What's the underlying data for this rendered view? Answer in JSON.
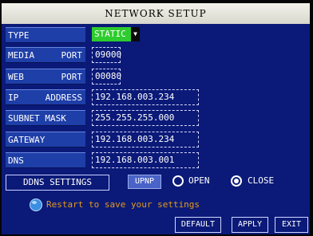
{
  "window": {
    "title": "NETWORK SETUP"
  },
  "form": {
    "type": {
      "label": "TYPE",
      "value": "STATIC"
    },
    "media_port": {
      "label_a": "MEDIA",
      "label_b": "PORT",
      "value": "09000"
    },
    "web_port": {
      "label_a": "WEB",
      "label_b": "PORT",
      "value": "00080"
    },
    "ip_address": {
      "label_a": "IP",
      "label_b": "ADDRESS",
      "value": "192.168.003.234"
    },
    "subnet_mask": {
      "label": "SUBNET MASK",
      "value": "255.255.255.000"
    },
    "gateway": {
      "label": "GATEWAY",
      "value": "192.168.003.234"
    },
    "dns": {
      "label": "DNS",
      "value": "192.168.003.001"
    }
  },
  "ddns": {
    "label": "DDNS SETTINGS"
  },
  "upnp": {
    "label": "UPNP",
    "options": [
      "OPEN",
      "CLOSE"
    ],
    "selected": "CLOSE"
  },
  "message": {
    "text": "Restart to save your settings"
  },
  "buttons": {
    "default": "DEFAULT",
    "apply": "APPLY",
    "exit": "EXIT"
  },
  "colors": {
    "panel": "#0b1a78",
    "label_bg": "#1e3ea8",
    "select_bg": "#2ecc2e",
    "message": "#e59a1a"
  },
  "icons": {
    "info": "info-icon",
    "dropdown": "triangle-down-icon"
  }
}
